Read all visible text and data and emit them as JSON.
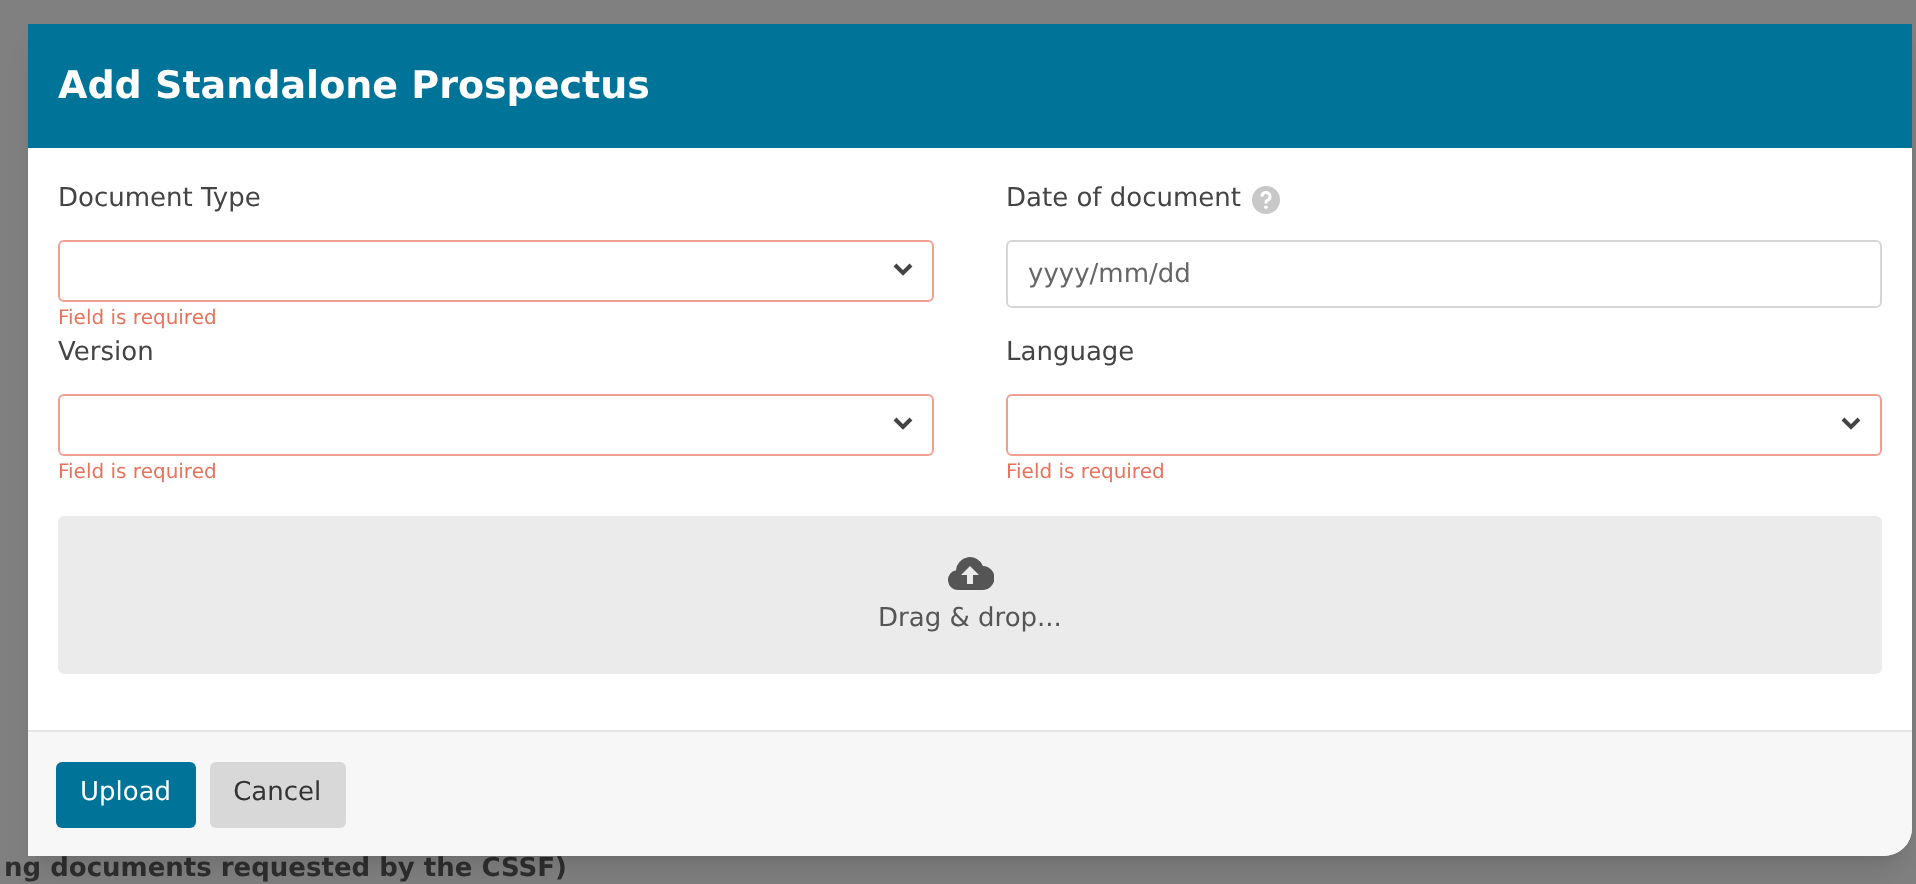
{
  "background": {
    "text": "ng documents requested by the CSSF)"
  },
  "dialog": {
    "title": "Add Standalone Prospectus",
    "fields": [
      {
        "kind": "select",
        "label": "Document Type",
        "help": false,
        "invalid": true,
        "error": "Field is required"
      },
      {
        "kind": "date",
        "label": "Date of document",
        "help": true,
        "invalid": false,
        "placeholder": "yyyy/mm/dd"
      },
      {
        "kind": "select",
        "label": "Version",
        "help": false,
        "invalid": true,
        "error": "Field is required"
      },
      {
        "kind": "select",
        "label": "Language",
        "help": false,
        "invalid": true,
        "error": "Field is required"
      }
    ],
    "dropzone": {
      "text": "Drag & drop..."
    },
    "buttons": [
      {
        "label": "Upload",
        "kind": "primary"
      },
      {
        "label": "Cancel",
        "kind": "secondary"
      }
    ]
  }
}
